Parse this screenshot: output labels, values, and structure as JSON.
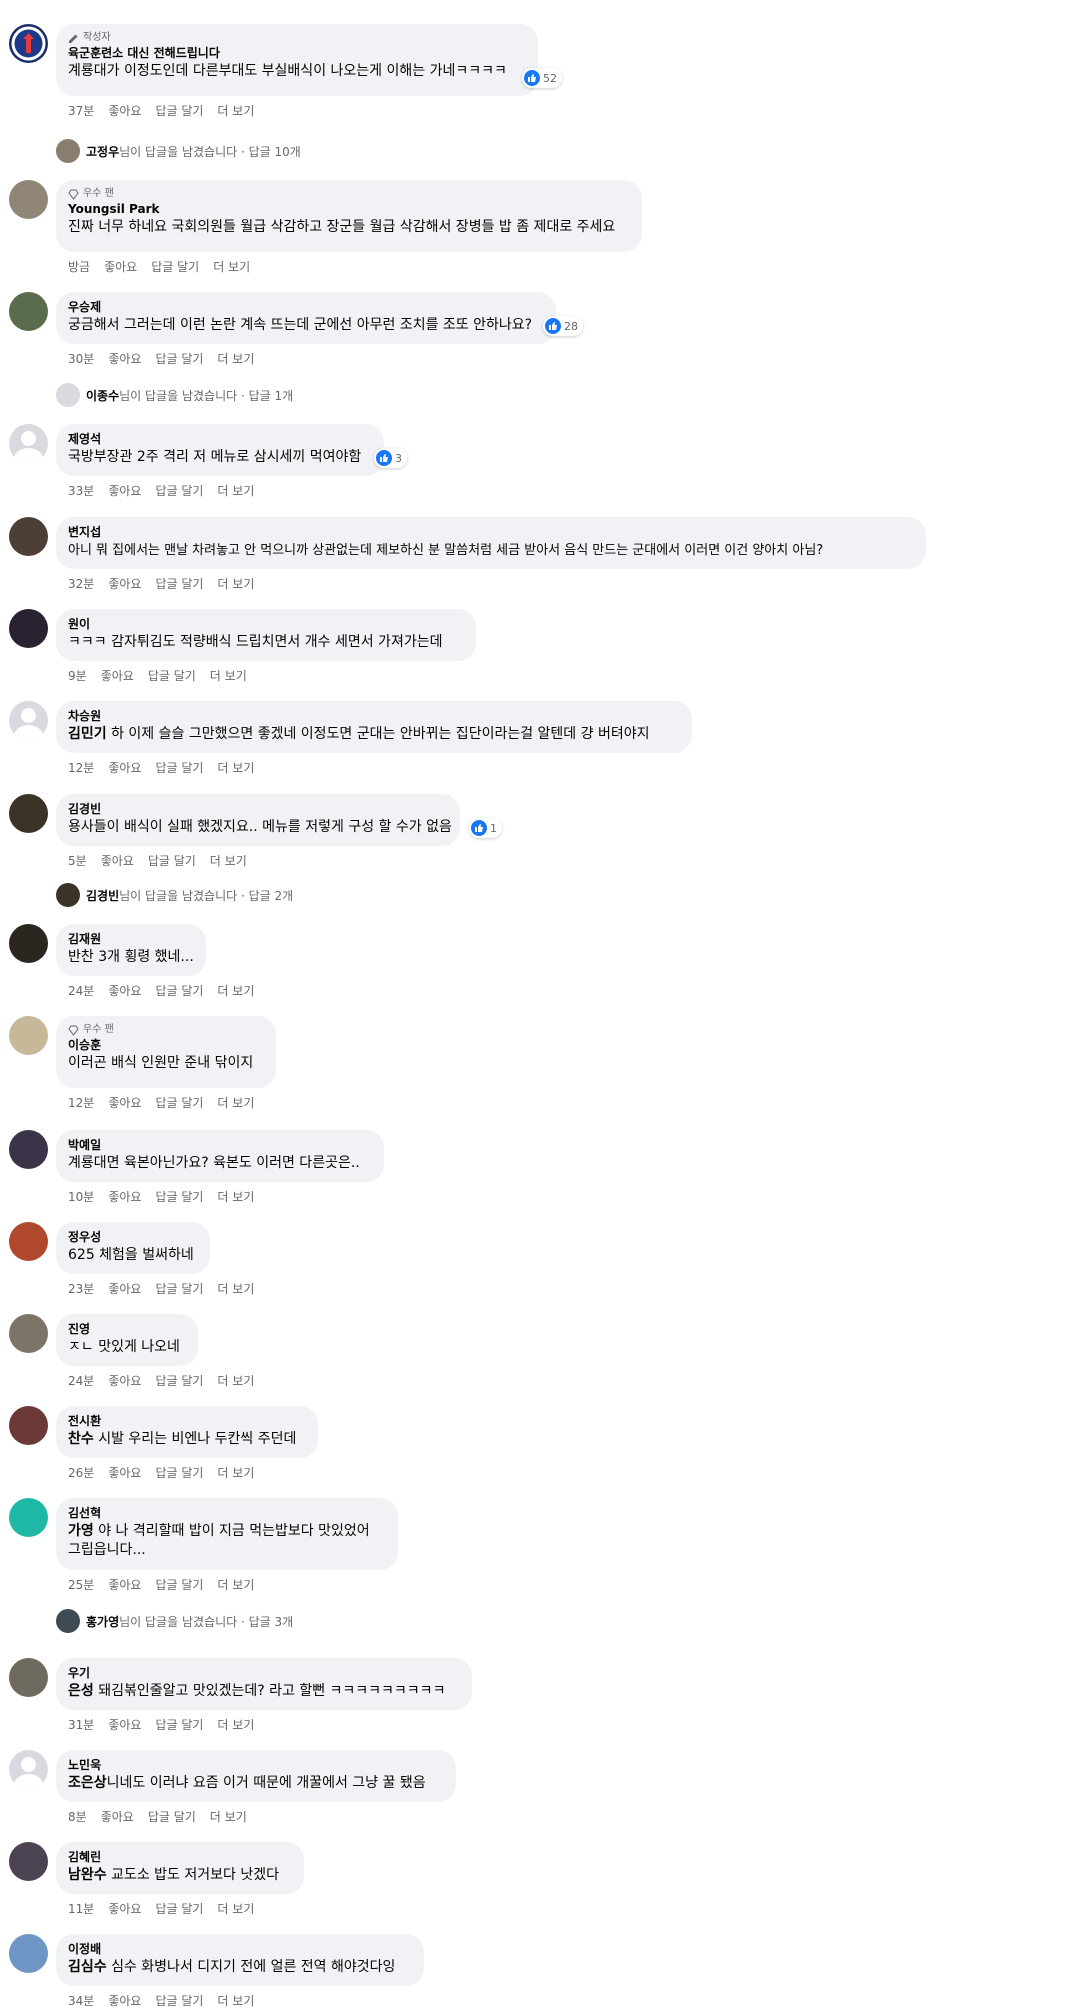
{
  "labels": {
    "like": "좋아요",
    "reply": "답글 달기",
    "more": "더 보기"
  },
  "comments": [
    {
      "author": "육군훈련소 대신 전해드립니다",
      "badge": "작성자",
      "text": "계룡대가 이정도인데 다른부대도 부실배식이 나오는게 이해는 가네ㅋㅋㅋㅋ",
      "time": "37분",
      "reactions": "52"
    },
    {
      "author": "Youngsil Park",
      "badge": "우수 팬",
      "text": "진짜 너무 하네요 국회의원들 월급 삭감하고 장군들 월급 삭감해서 장병들 밥 좀 제대로 주세요",
      "time": "방금"
    },
    {
      "author": "우승제",
      "text": "궁금해서 그러는데 이런 논란 계속 뜨는데 군에선 아무런 조치를 조또 안하나요?",
      "time": "30분",
      "reactions": "28"
    },
    {
      "author": "제영석",
      "text": "국방부장관 2주 격리 저 메뉴로 삼시세끼 먹여야함",
      "time": "33분",
      "reactions": "3"
    },
    {
      "author": "변지섭",
      "text": "아니 뭐 집에서는 맨날 차려놓고 안 먹으니까 상관없는데 제보하신 분 말씀처럼 세금 받아서 음식 만드는 군대에서 이러면 이건 양아치 아님?",
      "time": "32분"
    },
    {
      "author": "원이",
      "text": "ㅋㅋㅋ 감자튀김도 적량배식 드립치면서 개수 세면서 가져가는데",
      "time": "9분"
    },
    {
      "author": "차승원",
      "tag": "김민기",
      "text": " 하 이제 슬슬 그만했으면 좋겠네 이정도면 군대는 안바뀌는 집단이라는걸 알텐데 걍 버텨야지",
      "time": "12분"
    },
    {
      "author": "김경빈",
      "text": "용사들이 배식이 실패 했겠지요.. 메뉴를 저렇게 구성 할 수가 없음",
      "time": "5분",
      "reactions": "1"
    },
    {
      "author": "김재원",
      "text": "반찬 3개 횡령 했네...",
      "time": "24분"
    },
    {
      "author": "이승훈",
      "badge": "우수 팬",
      "text": "이러곤 배식 인원만 준내 닦이지",
      "time": "12분"
    },
    {
      "author": "박예일",
      "text": "계룡대면 육본아닌가요? 육본도 이러면 다른곳은..",
      "time": "10분"
    },
    {
      "author": "정우성",
      "text": "625 체험을 벌써하네",
      "time": "23분"
    },
    {
      "author": "진영",
      "text": "ㅈㄴ 맛있게 나오네",
      "time": "24분"
    },
    {
      "author": "전시환",
      "tag": "찬수",
      "text": " 시발 우리는 비엔나 두칸씩 주던데",
      "time": "26분"
    },
    {
      "author": "김선혁",
      "tag": "가영",
      "text": " 야 나 격리할때 밥이 지금 먹는밥보다 맛있었어",
      "text2": "그립읍니다...",
      "time": "25분"
    },
    {
      "author": "우기",
      "tag": "은성",
      "text": " 돼김볶인줄알고 맛있겠는데? 라고 할뻔 ㅋㅋㅋㅋㅋㅋㅋㅋㅋ",
      "time": "31분"
    },
    {
      "author": "노민욱",
      "tag": "조은상",
      "text": "니네도 이러냐 요즘 이거 때문에 개꿀에서 그냥 꿀 됐음",
      "time": "8분"
    },
    {
      "author": "김혜린",
      "tag": "남완수",
      "text": " 교도소 밥도 저거보다 낫겠다",
      "time": "11분"
    },
    {
      "author": "이정배",
      "tag": "김심수",
      "text": " 심수 화병나서 디지기 전에 얼른 전역 해야것다잉",
      "time": "34분"
    }
  ],
  "reply_rows": [
    {
      "name": "고정우",
      "suffix": "님이 답글을 남겼습니다",
      "count": " · 답글 10개"
    },
    {
      "name": "이종수",
      "suffix": "님이 답글을 남겼습니다",
      "count": " · 답글 1개"
    },
    {
      "name": "김경빈",
      "suffix": "님이 답글을 남겼습니다",
      "count": " · 답글 2개"
    },
    {
      "name": "홍가영",
      "suffix": "님이 답글을 남겼습니다",
      "count": " · 답글 3개"
    }
  ],
  "colors": {
    "bubble": "#f0f2f5",
    "meta": "#65676b",
    "like_blue": "#1877f2"
  }
}
